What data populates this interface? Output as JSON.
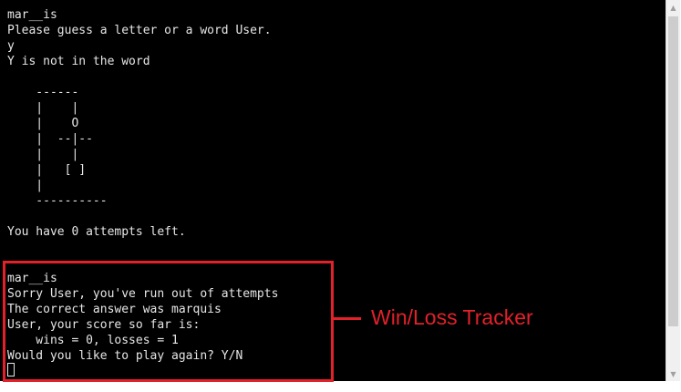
{
  "terminal": {
    "lines": [
      "mar__is",
      "Please guess a letter or a word User.",
      "y",
      "Y is not in the word",
      "",
      "    ------",
      "    |    |",
      "    |    O",
      "    |  --|--",
      "    |    |",
      "    |   [ ]",
      "    |",
      "    ----------",
      "",
      "You have 0 attempts left.",
      "",
      "",
      "mar__is",
      "Sorry User, you've run out of attempts",
      "The correct answer was marquis",
      "User, your score so far is:",
      "    wins = 0, losses = 1",
      "Would you like to play again? Y/N"
    ]
  },
  "annotation": {
    "label": "Win/Loss Tracker",
    "color": "#e3212b"
  },
  "icons": {
    "scroll_up": "triangle-up-icon",
    "scroll_down": "triangle-down-icon"
  }
}
